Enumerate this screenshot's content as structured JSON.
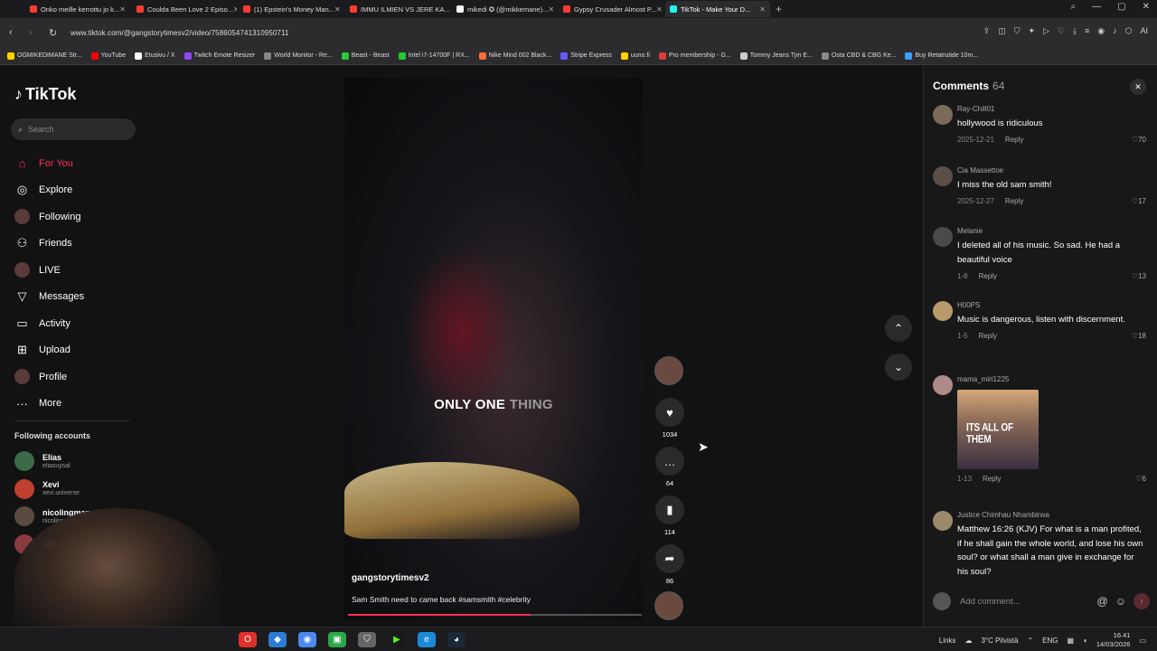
{
  "browser": {
    "tabs": [
      {
        "title": "Onko meille kerrottu jo k...",
        "color": "#ff3b30",
        "active": false
      },
      {
        "title": "Coulda Been Love 2 Episo...",
        "color": "#ff3b30",
        "active": false
      },
      {
        "title": "(1) Epstein's Money Man...",
        "color": "#ff3b30",
        "active": false
      },
      {
        "title": "IMMU ILMIEN VS JERE KA...",
        "color": "#ff3b30",
        "active": false
      },
      {
        "title": "mikedi ✪ (@mikkemane)...",
        "color": "#ffffff",
        "active": false
      },
      {
        "title": "Gypsy Crusader Almost P...",
        "color": "#ff3b30",
        "active": false
      },
      {
        "title": "TikTok - Make Your D...",
        "color": "#25f4ee",
        "active": true
      }
    ],
    "url": "www.tiktok.com/@gangstorytimesv2/video/7586054741310950711",
    "bookmarks": [
      {
        "label": "OGMIKEDIMANE Str...",
        "color": "#ffd400"
      },
      {
        "label": "YouTube",
        "color": "#ff0000"
      },
      {
        "label": "Etusivu / X",
        "color": "#ffffff"
      },
      {
        "label": "Twitch Emote Resizer",
        "color": "#9146ff"
      },
      {
        "label": "World Monitor - Re...",
        "color": "#888888"
      },
      {
        "label": "Beast - Beast",
        "color": "#27c93f"
      },
      {
        "label": "Intel i7-14700F | RX...",
        "color": "#27c93f"
      },
      {
        "label": "Nike Mind 002 Black...",
        "color": "#ff6b35"
      },
      {
        "label": "Stripe Express",
        "color": "#635bff"
      },
      {
        "label": "uuno.fi",
        "color": "#ffd400"
      },
      {
        "label": "Pro membership - G...",
        "color": "#e23b3b"
      },
      {
        "label": "Tommy Jeans Tjm E...",
        "color": "#cccccc"
      },
      {
        "label": "Osta CBD & CBG Ke...",
        "color": "#888888"
      },
      {
        "label": "Buy Retatrutide 10m...",
        "color": "#3aa0ff"
      }
    ]
  },
  "tiktok": {
    "logo": "TikTok",
    "search_placeholder": "Search",
    "menu": [
      {
        "label": "For You",
        "icon": "home-icon",
        "glyph": "⌂",
        "active": true
      },
      {
        "label": "Explore",
        "icon": "compass-icon",
        "glyph": "◎",
        "active": false
      },
      {
        "label": "Following",
        "icon": "following-avatar-icon",
        "glyph": "",
        "active": false
      },
      {
        "label": "Friends",
        "icon": "friends-icon",
        "glyph": "⚇",
        "active": false
      },
      {
        "label": "LIVE",
        "icon": "live-avatar-icon",
        "glyph": "",
        "active": false
      },
      {
        "label": "Messages",
        "icon": "messages-icon",
        "glyph": "▽",
        "active": false
      },
      {
        "label": "Activity",
        "icon": "activity-icon",
        "glyph": "▭",
        "active": false
      },
      {
        "label": "Upload",
        "icon": "upload-icon",
        "glyph": "⊞",
        "active": false
      },
      {
        "label": "Profile",
        "icon": "profile-avatar-icon",
        "glyph": "",
        "active": false
      },
      {
        "label": "More",
        "icon": "more-icon",
        "glyph": "···",
        "active": false
      }
    ],
    "following_title": "Following accounts",
    "following": [
      {
        "name": "Elias",
        "username": "eliasuysal",
        "color": "#3a6a4a"
      },
      {
        "name": "Xevi",
        "username": "xevi.universe",
        "color": "#c04030"
      },
      {
        "name": "nicolingman",
        "username": "nicolingman",
        "color": "#5a4a40"
      },
      {
        "name": "Oki",
        "username": "",
        "color": "#8a3a40"
      }
    ]
  },
  "video": {
    "caption_main": "ONLY ONE",
    "caption_dim": "THING",
    "username": "gangstorytimesv2",
    "description": "Sam Smith need to came back #samsmith #celebrity",
    "progress": 0.62,
    "likes": "1034",
    "comments": "64",
    "saves": "114",
    "shares": "86"
  },
  "comments": {
    "title": "Comments",
    "count": "64",
    "add_placeholder": "Add comment...",
    "items": [
      {
        "user": "Ray-Chill01",
        "text": "hollywood is ridiculous",
        "date": "2025-12-21",
        "likes": "70",
        "color": "#7a6a5a",
        "image_text": ""
      },
      {
        "user": "Cia Massettoe",
        "text": "I miss the old sam smith!",
        "date": "2025-12-27",
        "likes": "17",
        "color": "#5a5048",
        "image_text": ""
      },
      {
        "user": "Melanie",
        "text": "I deleted all of his music. So sad. He had a beautiful voice",
        "date": "1-8",
        "likes": "13",
        "color": "#4a4a4a",
        "image_text": ""
      },
      {
        "user": "H00PS",
        "text": "Music is dangerous, listen with discernment.",
        "date": "1-5",
        "likes": "18",
        "color": "#b89a6a",
        "image_text": ""
      },
      {
        "user": "mama_miri1225",
        "text": "",
        "date": "1-13",
        "likes": "6",
        "color": "#b08a8a",
        "image_text": "ITS ALL OF THEM"
      },
      {
        "user": "Justice Chimhau Nhambirwa",
        "text": "Matthew 16:26 (KJV) For what is a man profited, if he shall gain the whole world, and lose his own soul? or what shall a man give in exchange for his soul?",
        "date": "",
        "likes": "",
        "color": "#9a8a6a",
        "image_text": ""
      }
    ],
    "reply_label": "Reply"
  },
  "taskbar": {
    "links": "Links",
    "weather": "3°C Pilvistä",
    "lang": "ENG",
    "time": "16.41",
    "date": "14/03/2026"
  }
}
